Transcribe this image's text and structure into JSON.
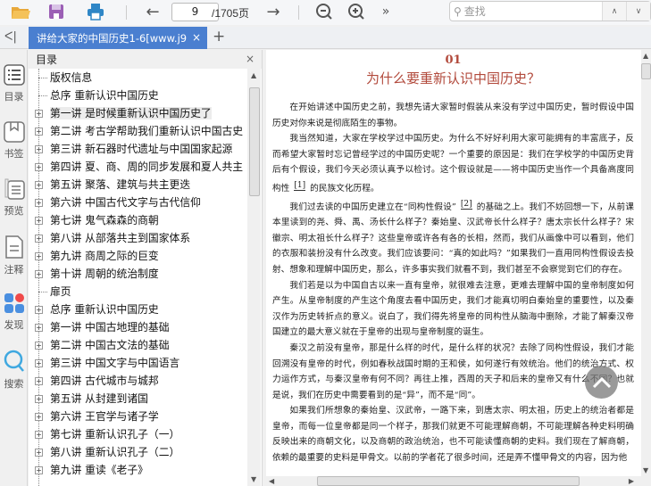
{
  "toolbar": {
    "page_current": "9",
    "page_total": "/1705页",
    "search_placeholder": "查找"
  },
  "tab": {
    "title": "讲给大家的中国历史1-6[www.j9",
    "close": "×",
    "add": "+",
    "collapse": "ᐸ|"
  },
  "rail": [
    {
      "label": "目录",
      "icon": "list-icon"
    },
    {
      "label": "书签",
      "icon": "bookmark-icon"
    },
    {
      "label": "预览",
      "icon": "preview-icon"
    },
    {
      "label": "注释",
      "icon": "note-icon"
    },
    {
      "label": "发现",
      "icon": "discover-icon"
    },
    {
      "label": "搜索",
      "icon": "search-icon"
    }
  ],
  "toc": {
    "title": "目录",
    "close": "×",
    "items": [
      {
        "label": "版权信息",
        "expandable": false
      },
      {
        "label": "总序 重新认识中国历史",
        "expandable": false
      },
      {
        "label": "第一讲 是时候重新认识中国历史了",
        "expandable": true,
        "selected": true
      },
      {
        "label": "第二讲 考古学帮助我们重新认识中国古史",
        "expandable": true
      },
      {
        "label": "第三讲 新石器时代遗址与中国国家起源",
        "expandable": true
      },
      {
        "label": "第四讲 夏、商、周的同步发展和夏人共主",
        "expandable": true
      },
      {
        "label": "第五讲 聚落、建筑与共主更迭",
        "expandable": true
      },
      {
        "label": "第六讲 中国古代文字与古代信仰",
        "expandable": true
      },
      {
        "label": "第七讲 鬼气森森的商朝",
        "expandable": true
      },
      {
        "label": "第八讲 从部落共主到国家体系",
        "expandable": true
      },
      {
        "label": "第九讲 商周之际的巨变",
        "expandable": true
      },
      {
        "label": "第十讲 周朝的统治制度",
        "expandable": true
      },
      {
        "label": "扉页",
        "expandable": false
      },
      {
        "label": "总序 重新认识中国历史",
        "expandable": true
      },
      {
        "label": "第一讲 中国古地理的基础",
        "expandable": true
      },
      {
        "label": "第二讲 中国古文法的基础",
        "expandable": true
      },
      {
        "label": "第三讲 中国文字与中国语言",
        "expandable": true
      },
      {
        "label": "第四讲 古代城市与城邦",
        "expandable": true
      },
      {
        "label": "第五讲 从封建到诸国",
        "expandable": true
      },
      {
        "label": "第六讲 王官学与诸子学",
        "expandable": true
      },
      {
        "label": "第七讲 重新认识孔子（一）",
        "expandable": true
      },
      {
        "label": "第八讲 重新认识孔子（二）",
        "expandable": true
      },
      {
        "label": "第九讲 重读《老子》",
        "expandable": true
      }
    ]
  },
  "document": {
    "chapter_number": "01",
    "chapter_title": "为什么要重新认识中国历史？",
    "p1": "在开始讲述中国历史之前，我想先请大家暂时假装从来没有学过中国历史，暂时假设中国历史对你来说是彻底陌生的事物。",
    "p2a": "我当然知道，大家在学校学过中国历史。为什么不好好利用大家可能拥有的丰富底子，反而希望大家暂时忘记曾经学过的中国历史呢？一个重要的原因是：我们在学校学的中国历史背后有个假设，我们今天必须认真予以检讨。这个假设就是——将中国历史当作一个具备高度同构性",
    "fn1": "[1]",
    "p2b": "的民族文化历程。",
    "p3a": "我们过去读的中国历史建立在“同构性假设”",
    "fn2": "[2]",
    "p3b": "的基础之上。我们不妨回想一下，从前课本里读到的尧、舜、禹、汤长什么样子？秦始皇、汉武帝长什么样子？唐太宗长什么样子？宋徽宗、明太祖长什么样子？这些皇帝或许各有各的长相，然而，我们从画像中可以看到，他们的衣服和装扮没有什么改变。我们应该要问：“真的如此吗？”如果我们一直用同构性假设去投射、想象和理解中国历史，那么，许多事实我们就看不到，我们甚至不会察觉到它们的存在。",
    "p4": "我们若是以为中国自古以来一直有皇帝，就很难去注意，更难去理解中国的皇帝制度如何产生。从皇帝制度的产生这个角度去看中国历史，我们才能真切明白秦始皇的重要性，以及秦汉作为历史转折点的意义。说白了，我们得先将皇帝的同构性从脑海中删除，才能了解秦汉帝国建立的最大意义就在于皇帝的出现与皇帝制度的诞生。",
    "p5": "秦汉之前没有皇帝，那是什么样的时代，是什么样的状况？去除了同构性假设，我们才能回溯没有皇帝的时代，例如春秋战国时期的王和侯，如何遂行有效统治。他们的统治方式、权力运作方式，与秦汉皇帝有何不同？再往上推，西周的天子和后来的皇帝又有什么不同？也就是说，我们在历史中需要看到的是“异”，而不是“同”。",
    "p6": "如果我们所想象的秦始皇、汉武帝，一路下来，到唐太宗、明太祖，历史上的统治者都是皇帝，而每一位皇帝都是同一个样子，那我们就更不可能理解商朝，不可能理解各种史料明确反映出来的商朝文化，以及商朝的政治统治，也不可能读懂商朝的史料。我们现在了解商朝，依赖的最重要的史料是甲骨文。以前的学者花了很多时间，还是弄不懂甲骨文的内容，因为他"
  },
  "colors": {
    "accent": "#4a7fd0",
    "chapter": "#b24a3c"
  }
}
